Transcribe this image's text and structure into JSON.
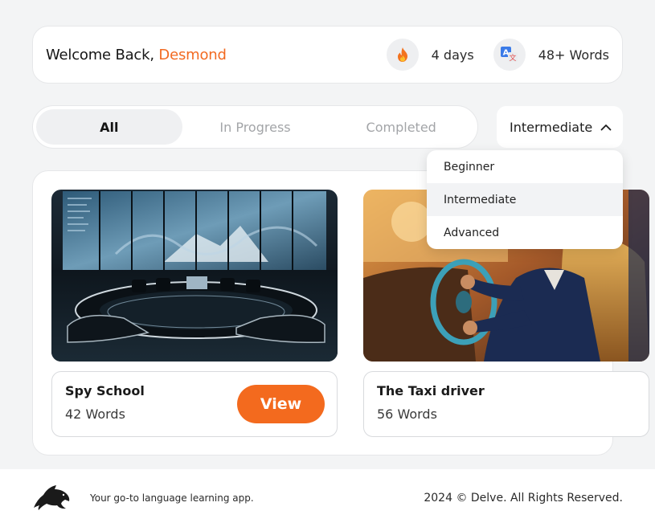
{
  "header": {
    "welcome_prefix": "Welcome Back,",
    "user_name": "Desmond",
    "streak": {
      "icon": "fire-icon",
      "label": "4 days"
    },
    "vocab": {
      "icon": "translate-icon",
      "label": "48+ Words"
    }
  },
  "tabs": [
    {
      "label": "All",
      "active": true
    },
    {
      "label": "In Progress",
      "active": false
    },
    {
      "label": "Completed",
      "active": false
    }
  ],
  "level_select": {
    "value": "Intermediate",
    "icon": "chevron-up-icon",
    "options": [
      "Beginner",
      "Intermediate",
      "Advanced"
    ],
    "selected_index": 1
  },
  "stories": [
    {
      "title": "Spy School",
      "words": "42 Words",
      "button": "View",
      "image": "spy-control-room-image"
    },
    {
      "title": "The Taxi driver",
      "words": "56 Words",
      "image": "taxi-driver-image"
    }
  ],
  "footer": {
    "logo": "dolphin-logo-icon",
    "tagline": "Your go-to language learning app.",
    "copyright": "2024 © Delve. All Rights Reserved."
  },
  "colors": {
    "accent": "#f26a21",
    "button": "#f36a1e",
    "background": "#f3f4f5"
  }
}
